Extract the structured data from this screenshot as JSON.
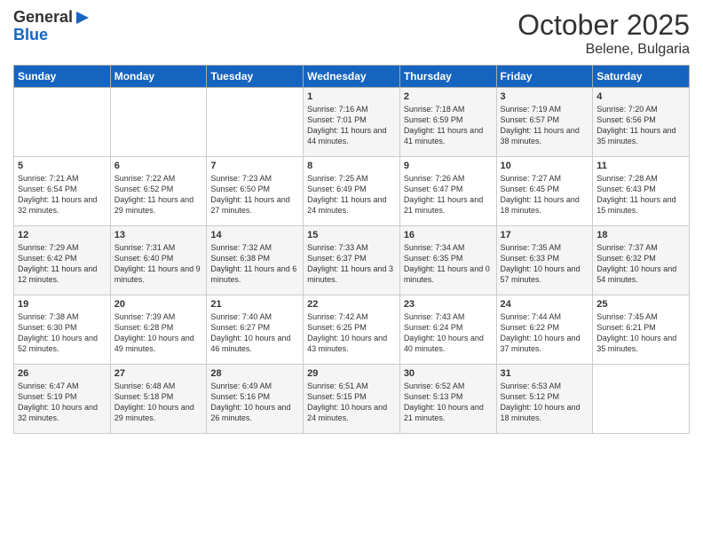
{
  "header": {
    "logo_general": "General",
    "logo_blue": "Blue",
    "month_title": "October 2025",
    "location": "Belene, Bulgaria"
  },
  "days_of_week": [
    "Sunday",
    "Monday",
    "Tuesday",
    "Wednesday",
    "Thursday",
    "Friday",
    "Saturday"
  ],
  "weeks": [
    [
      {
        "day": "",
        "content": ""
      },
      {
        "day": "",
        "content": ""
      },
      {
        "day": "",
        "content": ""
      },
      {
        "day": "1",
        "content": "Sunrise: 7:16 AM\nSunset: 7:01 PM\nDaylight: 11 hours and 44 minutes."
      },
      {
        "day": "2",
        "content": "Sunrise: 7:18 AM\nSunset: 6:59 PM\nDaylight: 11 hours and 41 minutes."
      },
      {
        "day": "3",
        "content": "Sunrise: 7:19 AM\nSunset: 6:57 PM\nDaylight: 11 hours and 38 minutes."
      },
      {
        "day": "4",
        "content": "Sunrise: 7:20 AM\nSunset: 6:56 PM\nDaylight: 11 hours and 35 minutes."
      }
    ],
    [
      {
        "day": "5",
        "content": "Sunrise: 7:21 AM\nSunset: 6:54 PM\nDaylight: 11 hours and 32 minutes."
      },
      {
        "day": "6",
        "content": "Sunrise: 7:22 AM\nSunset: 6:52 PM\nDaylight: 11 hours and 29 minutes."
      },
      {
        "day": "7",
        "content": "Sunrise: 7:23 AM\nSunset: 6:50 PM\nDaylight: 11 hours and 27 minutes."
      },
      {
        "day": "8",
        "content": "Sunrise: 7:25 AM\nSunset: 6:49 PM\nDaylight: 11 hours and 24 minutes."
      },
      {
        "day": "9",
        "content": "Sunrise: 7:26 AM\nSunset: 6:47 PM\nDaylight: 11 hours and 21 minutes."
      },
      {
        "day": "10",
        "content": "Sunrise: 7:27 AM\nSunset: 6:45 PM\nDaylight: 11 hours and 18 minutes."
      },
      {
        "day": "11",
        "content": "Sunrise: 7:28 AM\nSunset: 6:43 PM\nDaylight: 11 hours and 15 minutes."
      }
    ],
    [
      {
        "day": "12",
        "content": "Sunrise: 7:29 AM\nSunset: 6:42 PM\nDaylight: 11 hours and 12 minutes."
      },
      {
        "day": "13",
        "content": "Sunrise: 7:31 AM\nSunset: 6:40 PM\nDaylight: 11 hours and 9 minutes."
      },
      {
        "day": "14",
        "content": "Sunrise: 7:32 AM\nSunset: 6:38 PM\nDaylight: 11 hours and 6 minutes."
      },
      {
        "day": "15",
        "content": "Sunrise: 7:33 AM\nSunset: 6:37 PM\nDaylight: 11 hours and 3 minutes."
      },
      {
        "day": "16",
        "content": "Sunrise: 7:34 AM\nSunset: 6:35 PM\nDaylight: 11 hours and 0 minutes."
      },
      {
        "day": "17",
        "content": "Sunrise: 7:35 AM\nSunset: 6:33 PM\nDaylight: 10 hours and 57 minutes."
      },
      {
        "day": "18",
        "content": "Sunrise: 7:37 AM\nSunset: 6:32 PM\nDaylight: 10 hours and 54 minutes."
      }
    ],
    [
      {
        "day": "19",
        "content": "Sunrise: 7:38 AM\nSunset: 6:30 PM\nDaylight: 10 hours and 52 minutes."
      },
      {
        "day": "20",
        "content": "Sunrise: 7:39 AM\nSunset: 6:28 PM\nDaylight: 10 hours and 49 minutes."
      },
      {
        "day": "21",
        "content": "Sunrise: 7:40 AM\nSunset: 6:27 PM\nDaylight: 10 hours and 46 minutes."
      },
      {
        "day": "22",
        "content": "Sunrise: 7:42 AM\nSunset: 6:25 PM\nDaylight: 10 hours and 43 minutes."
      },
      {
        "day": "23",
        "content": "Sunrise: 7:43 AM\nSunset: 6:24 PM\nDaylight: 10 hours and 40 minutes."
      },
      {
        "day": "24",
        "content": "Sunrise: 7:44 AM\nSunset: 6:22 PM\nDaylight: 10 hours and 37 minutes."
      },
      {
        "day": "25",
        "content": "Sunrise: 7:45 AM\nSunset: 6:21 PM\nDaylight: 10 hours and 35 minutes."
      }
    ],
    [
      {
        "day": "26",
        "content": "Sunrise: 6:47 AM\nSunset: 5:19 PM\nDaylight: 10 hours and 32 minutes."
      },
      {
        "day": "27",
        "content": "Sunrise: 6:48 AM\nSunset: 5:18 PM\nDaylight: 10 hours and 29 minutes."
      },
      {
        "day": "28",
        "content": "Sunrise: 6:49 AM\nSunset: 5:16 PM\nDaylight: 10 hours and 26 minutes."
      },
      {
        "day": "29",
        "content": "Sunrise: 6:51 AM\nSunset: 5:15 PM\nDaylight: 10 hours and 24 minutes."
      },
      {
        "day": "30",
        "content": "Sunrise: 6:52 AM\nSunset: 5:13 PM\nDaylight: 10 hours and 21 minutes."
      },
      {
        "day": "31",
        "content": "Sunrise: 6:53 AM\nSunset: 5:12 PM\nDaylight: 10 hours and 18 minutes."
      },
      {
        "day": "",
        "content": ""
      }
    ]
  ]
}
